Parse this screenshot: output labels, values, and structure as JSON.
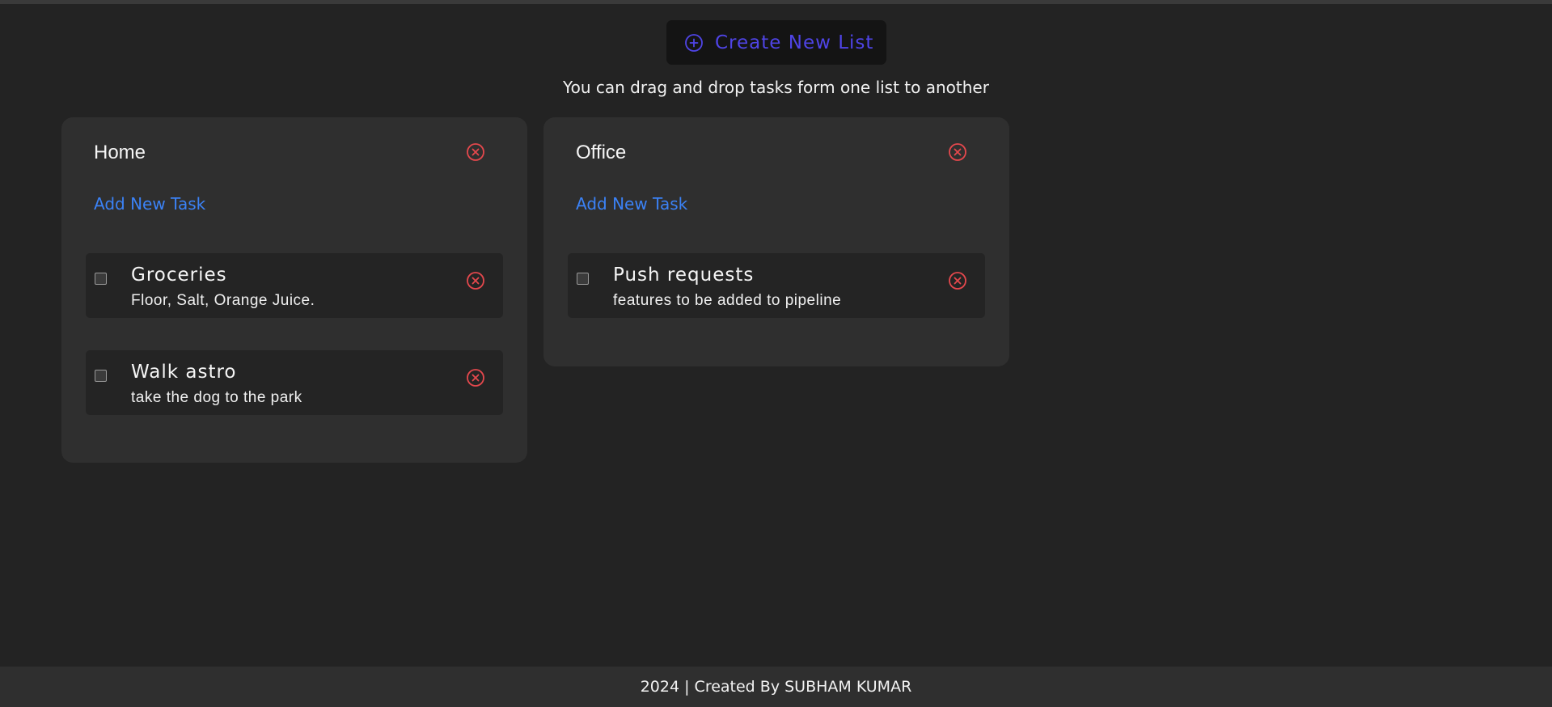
{
  "header": {
    "create_button_label": "Create New List",
    "hint": "You can drag and drop tasks form one list to another"
  },
  "colors": {
    "background": "#232323",
    "card": "#2f2f2f",
    "task": "#242424",
    "accent": "#4f44e6",
    "link": "#3b82f6",
    "danger": "#e5484d"
  },
  "icons": {
    "create": "plus-circle-icon",
    "delete": "x-circle-icon"
  },
  "lists": [
    {
      "title": "Home",
      "add_task_label": "Add New Task",
      "tasks": [
        {
          "title": "Groceries",
          "description": "Floor, Salt, Orange Juice.",
          "checked": false
        },
        {
          "title": "Walk astro",
          "description": "take the dog to the park",
          "checked": false
        }
      ]
    },
    {
      "title": "Office",
      "add_task_label": "Add New Task",
      "tasks": [
        {
          "title": "Push requests",
          "description": "features to be added to pipeline",
          "checked": false
        }
      ]
    }
  ],
  "footer": {
    "text": "2024 | Created By SUBHAM KUMAR"
  }
}
